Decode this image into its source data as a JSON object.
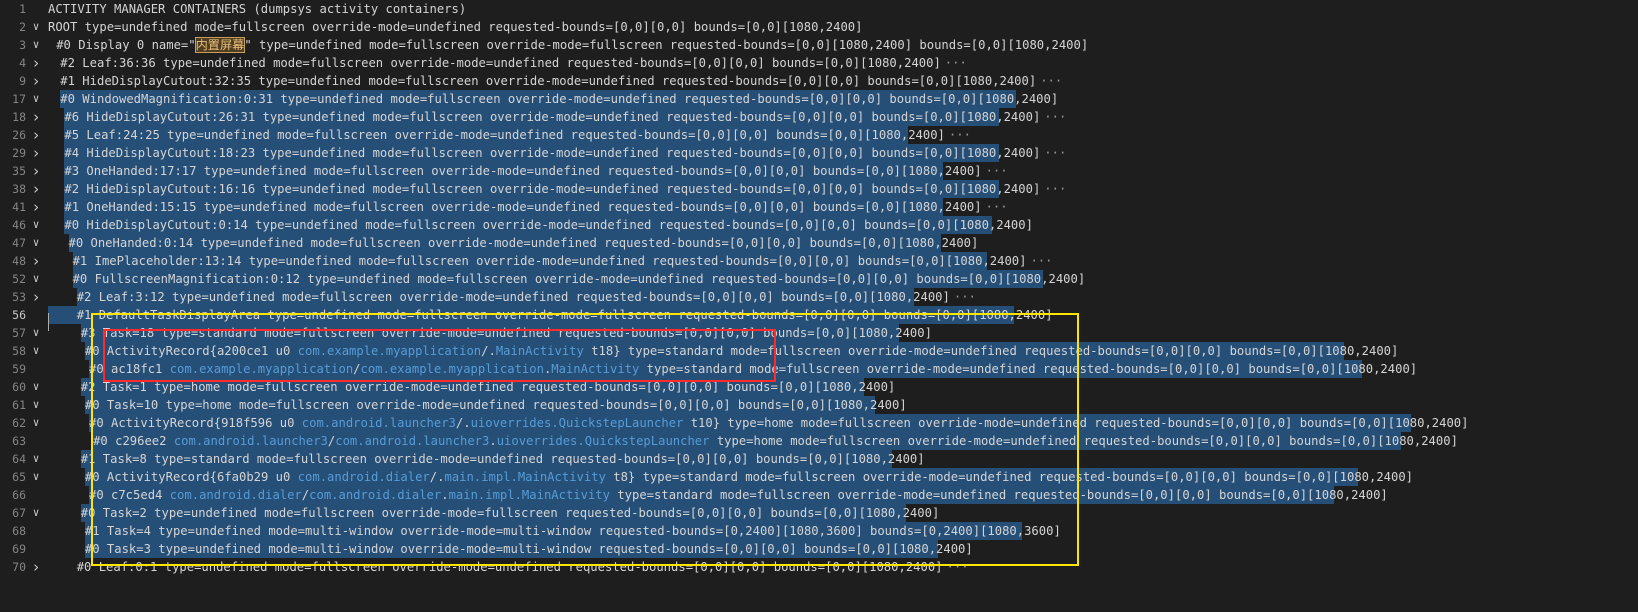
{
  "lines": [
    {
      "num": "1",
      "fold": "",
      "indent": 0,
      "text": "ACTIVITY MANAGER CONTAINERS (dumpsys activity containers)"
    },
    {
      "num": "2",
      "fold": "v",
      "indent": 0,
      "text": "ROOT type=undefined mode=fullscreen override-mode=undefined requested-bounds=[0,0][0,0] bounds=[0,0][1080,2400]"
    },
    {
      "num": "3",
      "fold": "v",
      "indent": 2,
      "text": "#0 Display 0 name=\"",
      "hl": "内置屏幕",
      "text2": "\" type=undefined mode=fullscreen override-mode=fullscreen requested-bounds=[0,0][1080,2400] bounds=[0,0][1080,2400]"
    },
    {
      "num": "4",
      "fold": ">",
      "indent": 3,
      "text": "#2 Leaf:36:36 type=undefined mode=fullscreen override-mode=undefined requested-bounds=[0,0][0,0] bounds=[0,0][1080,2400]",
      "ellipsis": true
    },
    {
      "num": "9",
      "fold": ">",
      "indent": 3,
      "text": "#1 HideDisplayCutout:32:35 type=undefined mode=fullscreen override-mode=undefined requested-bounds=[0,0][0,0] bounds=[0,0][1080,2400]",
      "ellipsis": true
    },
    {
      "num": "17",
      "fold": "v",
      "indent": 3,
      "text": "#0 WindowedMagnification:0:31 type=undefined mode=fullscreen override-mode=undefined requested-bounds=[0,0][0,0] bounds=[0,0][1080,2400]"
    },
    {
      "num": "18",
      "fold": ">",
      "indent": 4,
      "text": "#6 HideDisplayCutout:26:31 type=undefined mode=fullscreen override-mode=undefined requested-bounds=[0,0][0,0] bounds=[0,0][1080,2400]",
      "ellipsis": true
    },
    {
      "num": "26",
      "fold": ">",
      "indent": 4,
      "text": "#5 Leaf:24:25 type=undefined mode=fullscreen override-mode=undefined requested-bounds=[0,0][0,0] bounds=[0,0][1080,2400]",
      "ellipsis": true
    },
    {
      "num": "29",
      "fold": ">",
      "indent": 4,
      "text": "#4 HideDisplayCutout:18:23 type=undefined mode=fullscreen override-mode=undefined requested-bounds=[0,0][0,0] bounds=[0,0][1080,2400]",
      "ellipsis": true
    },
    {
      "num": "35",
      "fold": ">",
      "indent": 4,
      "text": "#3 OneHanded:17:17 type=undefined mode=fullscreen override-mode=undefined requested-bounds=[0,0][0,0] bounds=[0,0][1080,2400]",
      "ellipsis": true
    },
    {
      "num": "38",
      "fold": ">",
      "indent": 4,
      "text": "#2 HideDisplayCutout:16:16 type=undefined mode=fullscreen override-mode=undefined requested-bounds=[0,0][0,0] bounds=[0,0][1080,2400]",
      "ellipsis": true
    },
    {
      "num": "41",
      "fold": ">",
      "indent": 4,
      "text": "#1 OneHanded:15:15 type=undefined mode=fullscreen override-mode=undefined requested-bounds=[0,0][0,0] bounds=[0,0][1080,2400]",
      "ellipsis": true
    },
    {
      "num": "46",
      "fold": "v",
      "indent": 4,
      "text": "#0 HideDisplayCutout:0:14 type=undefined mode=fullscreen override-mode=undefined requested-bounds=[0,0][0,0] bounds=[0,0][1080,2400]"
    },
    {
      "num": "47",
      "fold": "v",
      "indent": 5,
      "text": "#0 OneHanded:0:14 type=undefined mode=fullscreen override-mode=undefined requested-bounds=[0,0][0,0] bounds=[0,0][1080,2400]"
    },
    {
      "num": "48",
      "fold": ">",
      "indent": 6,
      "text": "#1 ImePlaceholder:13:14 type=undefined mode=fullscreen override-mode=undefined requested-bounds=[0,0][0,0] bounds=[0,0][1080,2400]",
      "ellipsis": true
    },
    {
      "num": "52",
      "fold": "v",
      "indent": 6,
      "text": "#0 FullscreenMagnification:0:12 type=undefined mode=fullscreen override-mode=undefined requested-bounds=[0,0][0,0] bounds=[0,0][1080,2400]"
    },
    {
      "num": "53",
      "fold": ">",
      "indent": 7,
      "text": "#2 Leaf:3:12 type=undefined mode=fullscreen override-mode=undefined requested-bounds=[0,0][0,0] bounds=[0,0][1080,2400]",
      "ellipsis": true
    },
    {
      "num": "56",
      "fold": "",
      "indent": 7,
      "text": "#1 DefaultTaskDisplayArea type=undefined mode=fullscreen override-mode=fullscreen requested-bounds=[0,0][0,0] bounds=[0,0][1080,2400]",
      "current": true
    },
    {
      "num": "57",
      "fold": "v",
      "indent": 8,
      "text": "#3 Task=18 type=standard mode=fullscreen override-mode=undefined requested-bounds=[0,0][0,0] bounds=[0,0][1080,2400]"
    },
    {
      "num": "58",
      "fold": "v",
      "indent": 9,
      "text": "#0 ActivityRecord{a200ce1 u0 com.example.myapplication/.MainActivity t18} type=standard mode=fullscreen override-mode=undefined requested-bounds=[0,0][0,0] bounds=[0,0][1080,2400]"
    },
    {
      "num": "59",
      "fold": "",
      "indent": 10,
      "text": "#0 ac18fc1 com.example.myapplication/com.example.myapplication.MainActivity type=standard mode=fullscreen override-mode=undefined requested-bounds=[0,0][0,0] bounds=[0,0][1080,2400]"
    },
    {
      "num": "60",
      "fold": "v",
      "indent": 8,
      "text": "#2 Task=1 type=home mode=fullscreen override-mode=undefined requested-bounds=[0,0][0,0] bounds=[0,0][1080,2400]"
    },
    {
      "num": "61",
      "fold": "v",
      "indent": 9,
      "text": "#0 Task=10 type=home mode=fullscreen override-mode=undefined requested-bounds=[0,0][0,0] bounds=[0,0][1080,2400]"
    },
    {
      "num": "62",
      "fold": "v",
      "indent": 10,
      "text": "#0 ActivityRecord{918f596 u0 com.android.launcher3/.uioverrides.QuickstepLauncher t10} type=home mode=fullscreen override-mode=undefined requested-bounds=[0,0][0,0] bounds=[0,0][1080,2400]"
    },
    {
      "num": "63",
      "fold": "",
      "indent": 11,
      "text": "#0 c296ee2 com.android.launcher3/com.android.launcher3.uioverrides.QuickstepLauncher type=home mode=fullscreen override-mode=undefined requested-bounds=[0,0][0,0] bounds=[0,0][1080,2400]"
    },
    {
      "num": "64",
      "fold": "v",
      "indent": 8,
      "text": "#1 Task=8 type=standard mode=fullscreen override-mode=undefined requested-bounds=[0,0][0,0] bounds=[0,0][1080,2400]"
    },
    {
      "num": "65",
      "fold": "v",
      "indent": 9,
      "text": "#0 ActivityRecord{6fa0b29 u0 com.android.dialer/.main.impl.MainActivity t8} type=standard mode=fullscreen override-mode=undefined requested-bounds=[0,0][0,0] bounds=[0,0][1080,2400]"
    },
    {
      "num": "66",
      "fold": "",
      "indent": 10,
      "text": "#0 c7c5ed4 com.android.dialer/com.android.dialer.main.impl.MainActivity type=standard mode=fullscreen override-mode=undefined requested-bounds=[0,0][0,0] bounds=[0,0][1080,2400]"
    },
    {
      "num": "67",
      "fold": "v",
      "indent": 8,
      "text": "#0 Task=2 type=undefined mode=fullscreen override-mode=fullscreen requested-bounds=[0,0][0,0] bounds=[0,0][1080,2400]"
    },
    {
      "num": "68",
      "fold": "",
      "indent": 9,
      "text": "#1 Task=4 type=undefined mode=multi-window override-mode=multi-window requested-bounds=[0,2400][1080,3600] bounds=[0,2400][1080,3600]"
    },
    {
      "num": "69",
      "fold": "",
      "indent": 9,
      "text": "#0 Task=3 type=undefined mode=multi-window override-mode=multi-window requested-bounds=[0,0][0,0] bounds=[0,0][1080,2400]"
    },
    {
      "num": "70",
      "fold": ">",
      "indent": 7,
      "text": "#0 Leaf:0:1 type=undefined mode=fullscreen override-mode=undefined requested-bounds=[0,0][0,0] bounds=[0,0][1080,2400]",
      "ellipsis": true
    }
  ],
  "ellipsis_char": "···",
  "colors": {
    "background": "#1e1e1e",
    "selection": "#264f78",
    "line_number": "#858585",
    "annotation_yellow": "#ffe400",
    "annotation_red": "#ff2a2a"
  }
}
